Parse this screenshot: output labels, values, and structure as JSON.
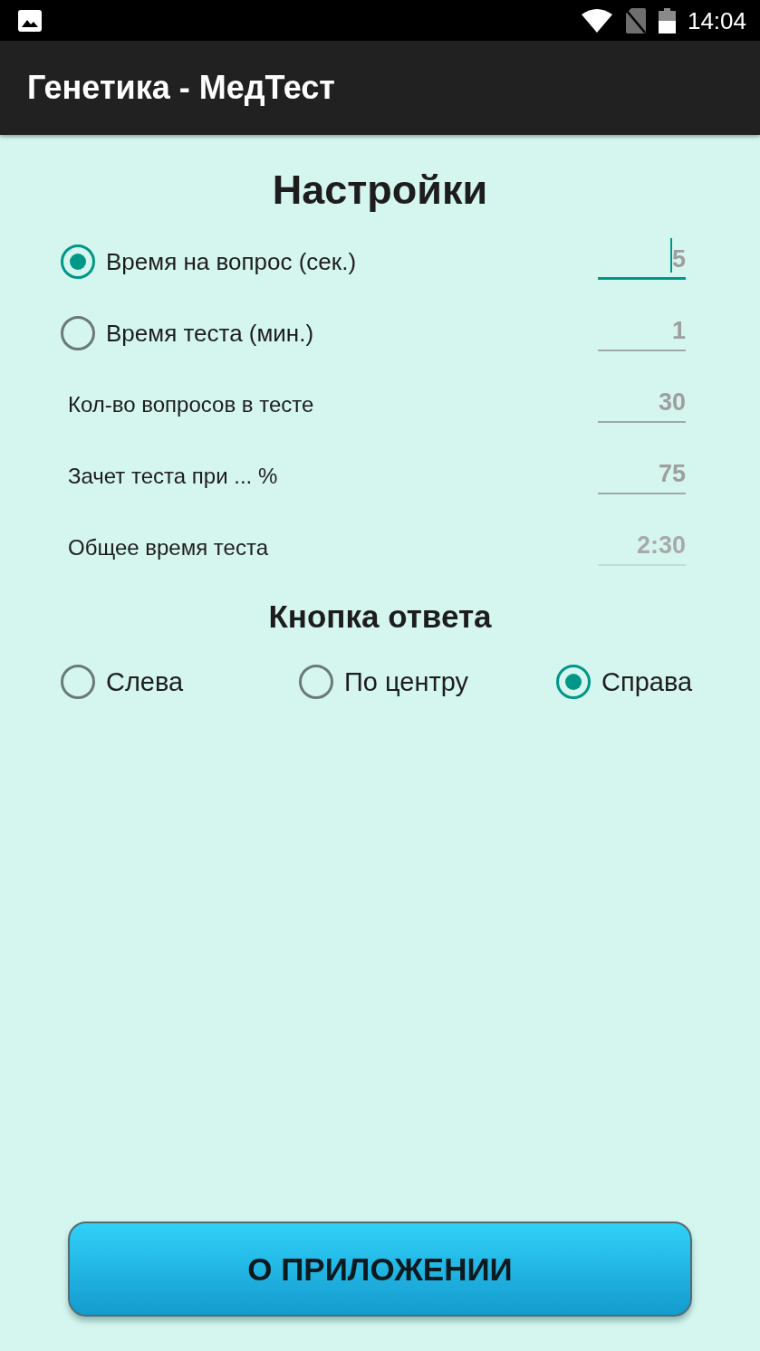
{
  "status_bar": {
    "time": "14:04"
  },
  "app_bar": {
    "title": "Генетика - МедТест"
  },
  "settings": {
    "title": "Настройки",
    "rows": [
      {
        "kind": "radio",
        "label": "Время на вопрос (сек.)",
        "selected": true,
        "value": "5",
        "focused": true,
        "disabled": false
      },
      {
        "kind": "radio",
        "label": "Время теста (мин.)",
        "selected": false,
        "value": "1",
        "focused": false,
        "disabled": false
      },
      {
        "kind": "plain",
        "label": "Кол-во вопросов в тесте",
        "value": "30",
        "focused": false,
        "disabled": false
      },
      {
        "kind": "plain",
        "label": "Зачет теста при ... %",
        "value": "75",
        "focused": false,
        "disabled": false
      },
      {
        "kind": "plain",
        "label": "Общее время теста",
        "value": "2:30",
        "focused": false,
        "disabled": true
      }
    ]
  },
  "answer_button": {
    "title": "Кнопка ответа",
    "options": [
      {
        "label": "Слева",
        "selected": false
      },
      {
        "label": "По центру",
        "selected": false
      },
      {
        "label": "Справа",
        "selected": true
      }
    ]
  },
  "about_button": {
    "label": "О ПРИЛОЖЕНИИ"
  }
}
